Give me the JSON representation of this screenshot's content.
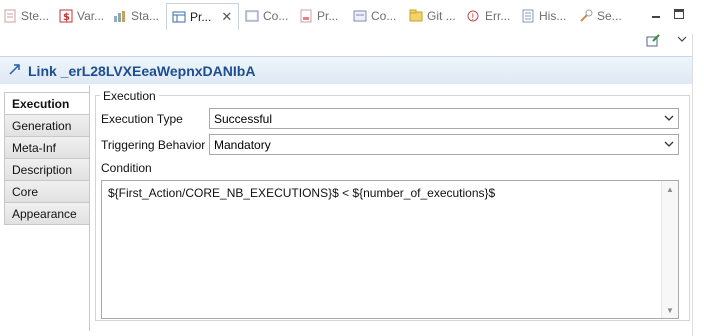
{
  "tabs": [
    {
      "label": "Ste...",
      "icon": "steps-icon"
    },
    {
      "label": "Var...",
      "icon": "variables-icon"
    },
    {
      "label": "Sta...",
      "icon": "statistics-icon"
    },
    {
      "label": "Pr...",
      "icon": "properties-icon",
      "active": true
    },
    {
      "label": "Co...",
      "icon": "console-icon"
    },
    {
      "label": "Pr...",
      "icon": "progress-icon"
    },
    {
      "label": "Co...",
      "icon": "coverage-icon"
    },
    {
      "label": "Git ...",
      "icon": "git-icon"
    },
    {
      "label": "Err...",
      "icon": "error-log-icon"
    },
    {
      "label": "His...",
      "icon": "history-icon"
    },
    {
      "label": "Se...",
      "icon": "search-icon"
    }
  ],
  "header": {
    "title": "Link _erL28LVXEeaWepnxDANIbA"
  },
  "sections": [
    "Execution",
    "Generation",
    "Meta-Inf",
    "Description",
    "Core",
    "Appearance"
  ],
  "form": {
    "group_title": "Execution",
    "execution_type_label": "Execution Type",
    "execution_type_value": "Successful",
    "triggering_label": "Triggering Behavior",
    "triggering_value": "Mandatory",
    "condition_label": "Condition",
    "condition_value": "${First_Action/CORE_NB_EXECUTIONS}$ < ${number_of_executions}$"
  }
}
